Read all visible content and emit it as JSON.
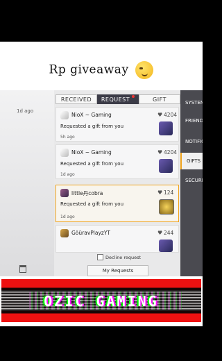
{
  "caption": {
    "text": "Rp giveaway",
    "emoji": "smirk-emoji"
  },
  "tabs": [
    {
      "label": "RECEIVED"
    },
    {
      "label": "REQUEST"
    },
    {
      "label": "GIFT"
    }
  ],
  "left_panel": {
    "time": "1d ago"
  },
  "requests": [
    {
      "name": "NioX ~ Gaming",
      "likes": "4204",
      "message": "Requested a gift from you",
      "ago": "5h ago"
    },
    {
      "name": "NioX ~ Gaming",
      "likes": "4204",
      "message": "Requested a gift from you",
      "ago": "1d ago"
    },
    {
      "name": "little丹cobra",
      "likes": "124",
      "message": "Requested a gift from you",
      "ago": "1d ago"
    },
    {
      "name": "GöüravPlayzYT",
      "likes": "244",
      "message": "",
      "ago": ""
    }
  ],
  "decline_label": "Decline request",
  "my_requests_label": "My Requests",
  "side_menu": [
    {
      "label": "SYSTEM"
    },
    {
      "label": "FRIENDS"
    },
    {
      "label": "NOTIFIC"
    },
    {
      "label": "GIFTS"
    },
    {
      "label": "SECURITY"
    }
  ],
  "banner": {
    "text": "OZIC GAMING"
  },
  "colors": {
    "accent": "#f0a31b",
    "active_tab": "#3b3b47",
    "banner_red": "#e11111"
  }
}
